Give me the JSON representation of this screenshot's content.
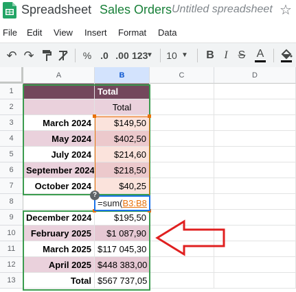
{
  "titlebar": {
    "app_name": "Spreadsheet",
    "doc_name": "Sales Orders",
    "doc_subtitle": "Untitled spreadsheet",
    "star_icon": "☆"
  },
  "menu": [
    "File",
    "Edit",
    "View",
    "Insert",
    "Format",
    "Data"
  ],
  "toolbar": {
    "undo": "↶",
    "redo": "↷",
    "paint_format": "🖌",
    "clear_format": "T̸",
    "percent": "%",
    "dec_decrease": ".0",
    "dec_increase": ".00",
    "more_formats": "123",
    "font_size": "10",
    "bold": "B",
    "italic": "I",
    "strike": "S",
    "text_color": "A",
    "fill_color": "◆"
  },
  "columns": [
    "A",
    "B",
    "C",
    "D"
  ],
  "rows": [
    {
      "num": "1",
      "a": "",
      "b": "Total"
    },
    {
      "num": "2",
      "a": "",
      "b": "Total"
    },
    {
      "num": "3",
      "a": "March 2024",
      "b": "$149,50"
    },
    {
      "num": "4",
      "a": "May 2024",
      "b": "$402,50"
    },
    {
      "num": "5",
      "a": "July 2024",
      "b": "$214,60"
    },
    {
      "num": "6",
      "a": "September 2024",
      "b": "$218,50"
    },
    {
      "num": "7",
      "a": "October 2024",
      "b": "$40,25"
    },
    {
      "num": "8",
      "a": "",
      "b": ""
    },
    {
      "num": "9",
      "a": "December 2024",
      "b": "$195,50"
    },
    {
      "num": "10",
      "a": "February 2025",
      "b": "$1 087,90"
    },
    {
      "num": "11",
      "a": "March 2025",
      "b": "$117 045,30"
    },
    {
      "num": "12",
      "a": "April 2025",
      "b": "$448 383,00"
    },
    {
      "num": "13",
      "a": "Total",
      "b": "$567 737,05"
    }
  ],
  "formula": {
    "prefix": "=sum(",
    "range": "B3:B8"
  },
  "help_badge": "?",
  "colors": {
    "header_purple": "#73475c",
    "row_pink": "#ead1dc",
    "row_pink_dark": "#e6c8d3",
    "green_border": "#3a9b4e",
    "selection_orange": "#e8710a",
    "arrow_red": "#e02020",
    "formula_blue": "#1a73e8"
  }
}
